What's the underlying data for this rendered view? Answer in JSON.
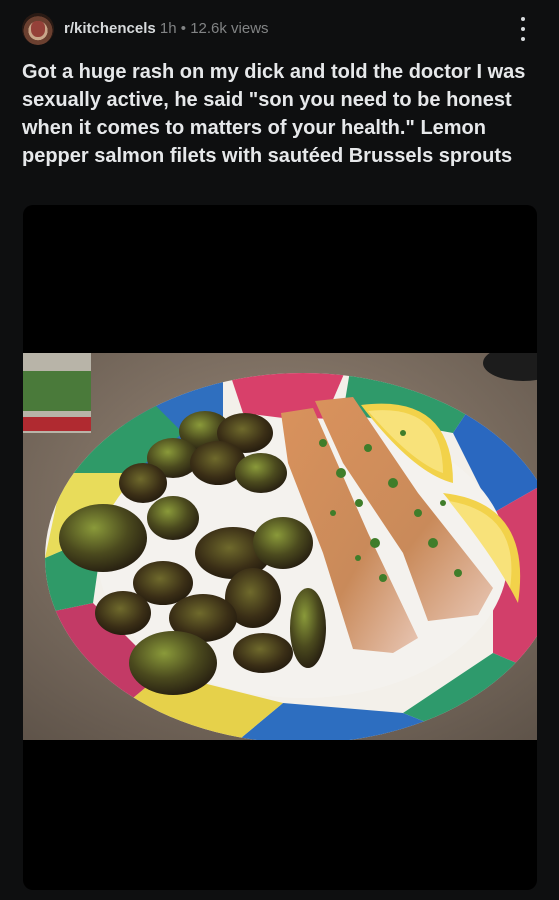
{
  "post": {
    "subreddit": "r/kitchencels",
    "age": "1h",
    "separator": "•",
    "views": "12.6k views",
    "title": "Got a huge rash on my dick and told the doctor I was sexually active, he said \"son you need to be honest when it comes to matters of your health.\" Lemon pepper salmon filets with sautéed Brussels sprouts"
  },
  "icons": {
    "avatar": "subreddit-avatar",
    "menu": "more-vertical-icon"
  },
  "colors": {
    "background": "#0e0f10",
    "text": "#d7dadc",
    "muted": "#818384"
  }
}
